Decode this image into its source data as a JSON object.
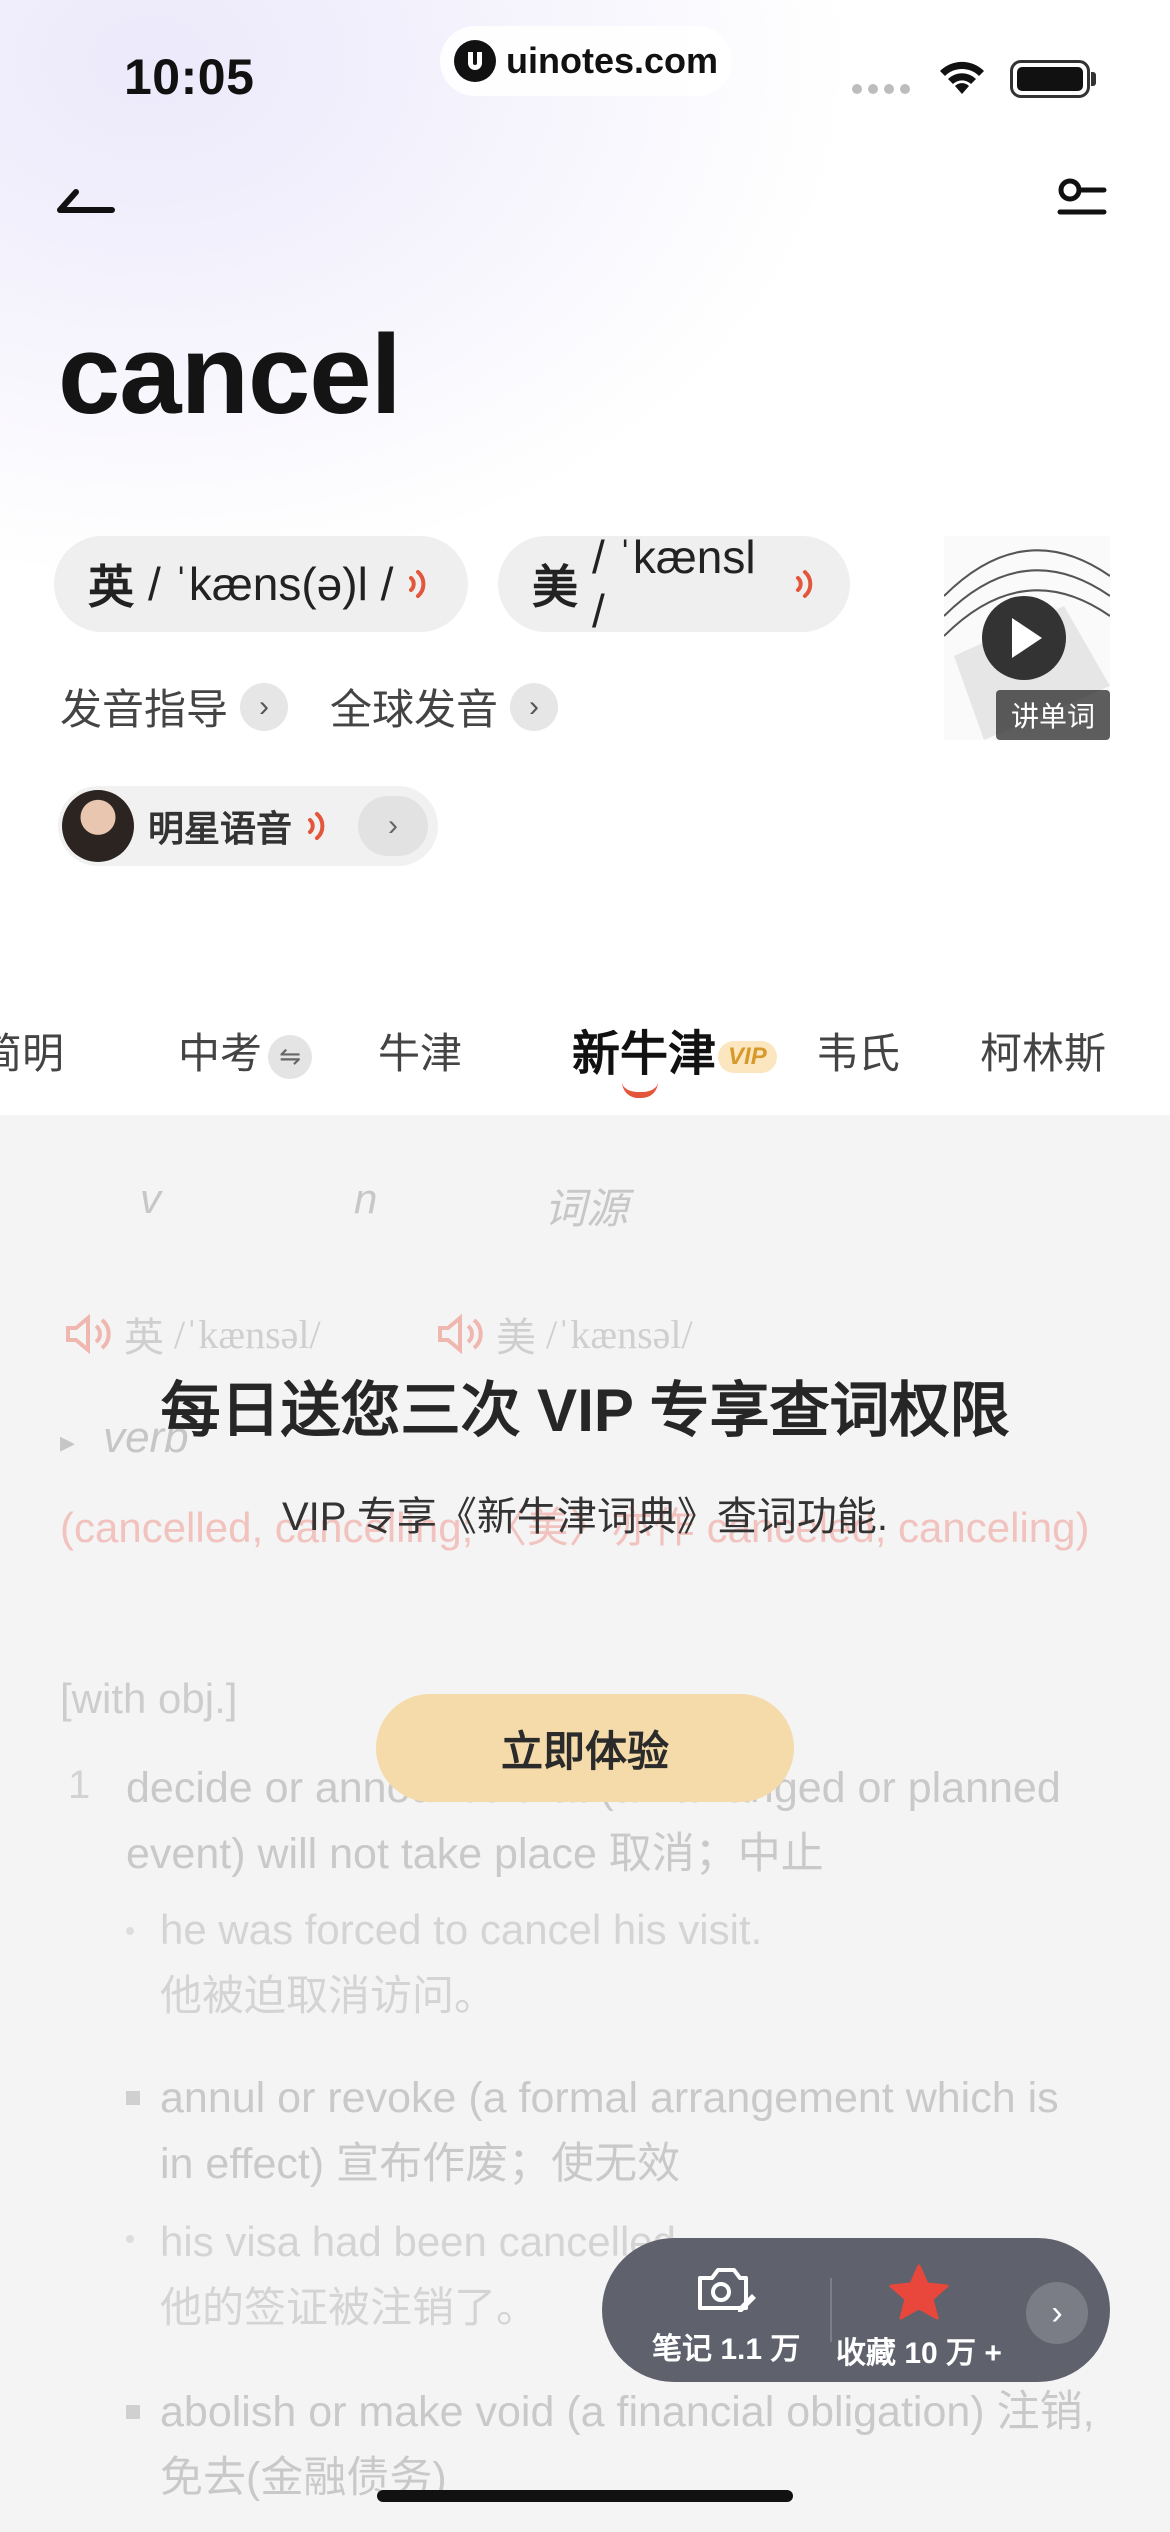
{
  "status_bar": {
    "time": "10:05",
    "url": "uinotes.com"
  },
  "word": "cancel",
  "pronunciation": {
    "uk": {
      "lang": "英",
      "ipa": "/ ˈkæns(ə)l /"
    },
    "us": {
      "lang": "美",
      "ipa": "/ ˈkænsl /"
    },
    "guide_label": "发音指导",
    "global_label": "全球发音",
    "celebrity_label": "明星语音",
    "video_label": "讲单词"
  },
  "tabs": {
    "items": [
      "简明",
      "中考",
      "牛津",
      "新牛津",
      "韦氏",
      "柯林斯"
    ],
    "vip_badge": "VIP"
  },
  "content": {
    "sub_tabs": [
      "v",
      "n",
      "词源"
    ],
    "uk_phonetic": {
      "lang": "英",
      "ipa": "/ˈkænsəl/"
    },
    "us_phonetic": {
      "lang": "美",
      "ipa": "/ˈkænsəl/"
    },
    "pos": "verb",
    "inflection": "(cancelled, cancelling; 〈美〉亦作 canceled, canceling)",
    "grammar": "[with obj.]",
    "def_num": "1",
    "def1": "decide or announce that (an arranged or planned event) will not take place 取消；中止",
    "ex1_en": "he was forced to cancel his visit.",
    "ex1_zh": "他被迫取消访问。",
    "def2": "annul or revoke (a formal arrangement which is in effect) 宣布作废；使无效",
    "ex2_en": "his visa had been cancelled.",
    "ex2_zh": "他的签证被注销了。",
    "def3": "abolish or make void (a financial obligation) 注销,免去(金融债务)"
  },
  "overlay": {
    "title": "每日送您三次 VIP 专享查词权限",
    "subtitle": "VIP 专享《新牛津词典》查词功能.",
    "button": "立即体验"
  },
  "action_bar": {
    "notes_label": "笔记 1.1 万",
    "favorite_label": "收藏 10 万 +"
  },
  "colors": {
    "accent": "#e4563b",
    "vip_button": "#f5dba9",
    "action_bar": "#5f626c"
  }
}
